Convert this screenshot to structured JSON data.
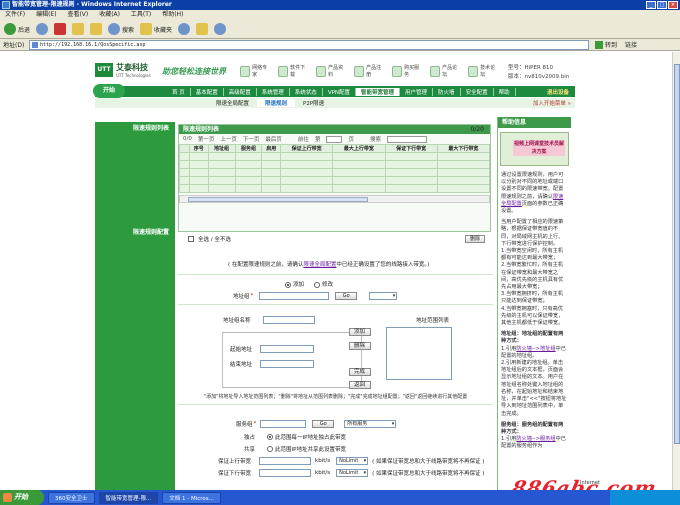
{
  "window": {
    "title": "智能带宽管理-限速规则 - Windows Internet Explorer"
  },
  "menu": [
    "文件(F)",
    "编辑(E)",
    "查看(V)",
    "收藏(A)",
    "工具(T)",
    "帮助(H)"
  ],
  "toolbar": {
    "back": "后退",
    "search": "搜索",
    "favorites": "收藏夹"
  },
  "address": {
    "label": "地址(D)",
    "url": "http://192.168.16.1/QosSpecific.asp",
    "go": "转到",
    "links": "链接"
  },
  "brand": {
    "name": "艾泰科技",
    "en": "UTT Technologies",
    "logo": "UTT",
    "slogan": "助您轻松连接世界"
  },
  "top_icons": [
    "网络专家",
    "软件下载",
    "产品资料",
    "产品注册",
    "购买服务",
    "产品论坛",
    "技术论坛"
  ],
  "model": {
    "model": "型号：HiPER 810",
    "version": "版本：nv810v2009.bin"
  },
  "nav": {
    "start": "开始",
    "items": [
      "首 页",
      "基本配置",
      "高级配置",
      "系统管理",
      "系统状态",
      "VPN配置",
      "智能带宽管理",
      "用户管理",
      "防火墙",
      "安全配置",
      "帮助"
    ],
    "active_index": 6,
    "right": "退出设备"
  },
  "subnav": {
    "items": [
      "限速全局配置",
      "限速规则",
      "P2P限速"
    ],
    "active_index": 1,
    "fav": "加入开始菜单 »"
  },
  "left": {
    "list_title": "限速规则列表",
    "config_title": "限速规则配置"
  },
  "list": {
    "title": "限速规则列表",
    "count": "0/20",
    "pager": {
      "pos": "0/0",
      "first": "第一页",
      "prev": "上一页",
      "next": "下一页",
      "last": "最后页",
      "goto": "前往",
      "page_prefix": "第",
      "page_suffix": "页",
      "search": "搜索"
    },
    "columns": [
      "序号",
      "地址组",
      "服务组",
      "启用",
      "保证上行带宽",
      "最大上行带宽",
      "保证下行带宽",
      "最大下行带宽"
    ],
    "select_all": "全选 / 全不选",
    "delete": "删除"
  },
  "form": {
    "note_pre": "( 在配置限速规则之前，请确认",
    "note_link": "限速全局配置",
    "note_post": "中已经正确设置了您的线路接入带宽。)",
    "mode_add": "添加",
    "mode_edit": "修改",
    "addr_group_label": "地址组",
    "go_label": "Go",
    "addr_group_name_label": "地址组名称",
    "start_addr_label": "起始地址",
    "end_addr_label": "结束地址",
    "addr_list_label": "地址范围列表",
    "btn_add": "添加",
    "btn_delete": "删除",
    "btn_done": "完成",
    "btn_back": "返回",
    "hint": "\"添加\"将地址导入地址范围列表；\"删除\"将地址从范围列表删除；\"完成\"完成地址组配置；\"返回\"返回继续进行其他配置",
    "service_group_label": "服务组",
    "service_select": "所有服务",
    "exclusive_label": "独占",
    "exclusive_text": "此范围每一IP地址独占此带宽",
    "share_label": "共享",
    "share_text": "此范围IP地址共享此设置带宽",
    "up_label": "保证上行带宽",
    "down_label": "保证下行带宽",
    "unit": "kbit/s",
    "nolimit": "NoLimit",
    "up_note": "( 如果保证带宽总和大于线路带宽将不再保证 )",
    "down_note": "( 如果保证带宽总和大于线路带宽将不再保证 )"
  },
  "help": {
    "title": "帮助信息",
    "video_tag": "视频上网课堂技术员解决方案",
    "p1_pre": "通过设置限速规则，用户可以分别对不同的地址或端口设置不同的限速带宽。配置限速规则之前，请确认",
    "p1_link": "限速全局配置",
    "p1_post": "页面的参数已正确设置。",
    "p2": "当用户配置了相应的限速策略，根据保证带宽值的不同，对局域网主机的上行、下行带宽进行保护控制。",
    "p3": "1.当带宽空闲时，所有主机都有可能达到最大带宽；",
    "p4": "2.当带宽繁忙时，所有主机在保证带宽和最大带宽之间，高优先级的主机具有优先占用最大带宽；",
    "p5": "3.当带宽拥挤时，所有主机只能达到保证带宽；",
    "p6": "4.当带宽拥塞时，只有高优先级的主机可以保证带宽，其他主机都低于保证带宽。",
    "p7": "地址组：地址组的配置有两种方式：",
    "p8_pre": "1.引用",
    "p8_link": "防火墙-->地址组",
    "p8_post": "中已配置的地址组。",
    "p9": "2.引用新建的地址组。单击地址组后的文本框，页面会显示地址组的文本。用户在地址组名称处键入地址组的名称，在起始地址和结束地址，并单击\"<<\"按钮将地址导入到地址范围列表中，单击完成。",
    "p10": "服务组：服务组的配置有两种方式：",
    "p11_pre": "1.引用",
    "p11_link": "防火墙-->服务组",
    "p11_post": "中已配置的服务组作为"
  },
  "taskbar": {
    "start": "开始",
    "tasks": [
      "360安全卫士",
      "智能带宽管理-限...",
      "文档 1 - Micros..."
    ],
    "active_index": 1
  },
  "status": {
    "zone": "Internet"
  },
  "watermark": "886abc.com"
}
